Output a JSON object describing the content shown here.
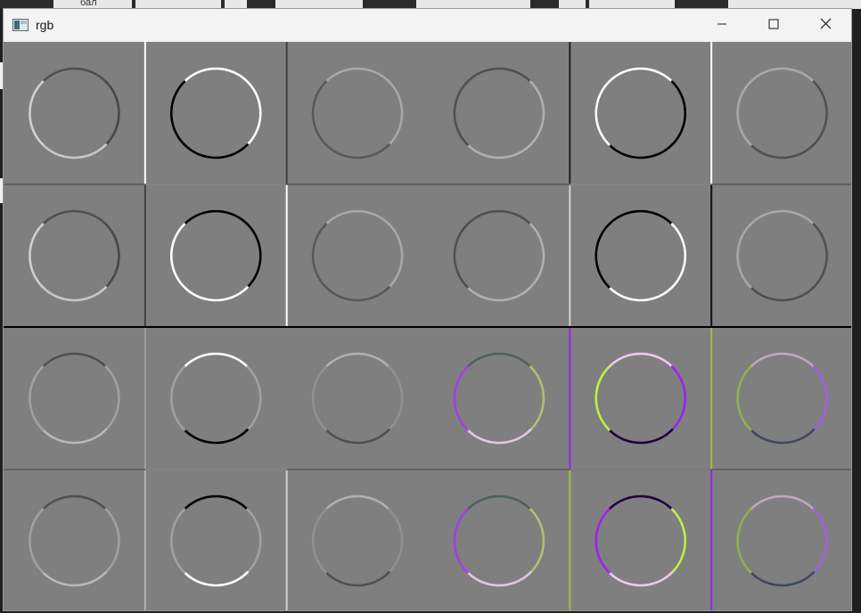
{
  "window": {
    "title": "rgb"
  },
  "background_window": {
    "label": "бал"
  },
  "icons": {
    "app": "image-window-icon",
    "minimize": "minimize-icon",
    "maximize": "maximize-icon",
    "close": "close-icon"
  },
  "colors": {
    "canvas_gray": "#7f7f7f",
    "titlebar": "#f3f3f3",
    "purple": "#a020f0",
    "yellow_green": "#c0f040",
    "pink": "#f0c0e0"
  },
  "grid": {
    "rows": 4,
    "cols": 6,
    "cells": [
      [
        {
          "top": "#505050",
          "bottom": "#c8c8c8",
          "left": "#d0d0d0",
          "right": "#484848"
        },
        {
          "top": "#ffffff",
          "bottom": "#000000",
          "left": "#000000",
          "right": "#ffffff"
        },
        {
          "top": "#a8a8a8",
          "bottom": "#585858",
          "left": "#585858",
          "right": "#a8a8a8"
        },
        {
          "top": "#505050",
          "bottom": "#b0b0b0",
          "left": "#505050",
          "right": "#b0b0b0"
        },
        {
          "top": "#ffffff",
          "bottom": "#000000",
          "left": "#ffffff",
          "right": "#000000"
        },
        {
          "top": "#a8a8a8",
          "bottom": "#505050",
          "left": "#a8a8a8",
          "right": "#505050"
        }
      ],
      [
        {
          "top": "#505050",
          "bottom": "#c8c8c8",
          "left": "#d0d0d0",
          "right": "#484848"
        },
        {
          "top": "#000000",
          "bottom": "#ffffff",
          "left": "#ffffff",
          "right": "#000000"
        },
        {
          "top": "#a8a8a8",
          "bottom": "#585858",
          "left": "#585858",
          "right": "#a8a8a8"
        },
        {
          "top": "#505050",
          "bottom": "#b0b0b0",
          "left": "#505050",
          "right": "#b0b0b0"
        },
        {
          "top": "#000000",
          "bottom": "#ffffff",
          "left": "#000000",
          "right": "#ffffff"
        },
        {
          "top": "#a8a8a8",
          "bottom": "#505050",
          "left": "#a8a8a8",
          "right": "#505050"
        }
      ],
      [
        {
          "top": "#505050",
          "bottom": "#b8b8b8",
          "left": "#a0a0a0",
          "right": "#a0a0a0"
        },
        {
          "top": "#ffffff",
          "bottom": "#000000",
          "left": "#a0a0a0",
          "right": "#a0a0a0"
        },
        {
          "top": "#b0b0b0",
          "bottom": "#505050",
          "left": "#909090",
          "right": "#909090"
        },
        {
          "top": "#506060",
          "bottom": "#e0c8e0",
          "left": "#a040e0",
          "right": "#b0c070"
        },
        {
          "top": "#f0c8f0",
          "bottom": "#200040",
          "left": "#c0f040",
          "right": "#a020f0"
        },
        {
          "top": "#c0a8c0",
          "bottom": "#404860",
          "left": "#90b050",
          "right": "#a060e0"
        }
      ],
      [
        {
          "top": "#505050",
          "bottom": "#b8b8b8",
          "left": "#a0a0a0",
          "right": "#a0a0a0"
        },
        {
          "top": "#000000",
          "bottom": "#ffffff",
          "left": "#a0a0a0",
          "right": "#a0a0a0"
        },
        {
          "top": "#b0b0b0",
          "bottom": "#505050",
          "left": "#909090",
          "right": "#909090"
        },
        {
          "top": "#506060",
          "bottom": "#e0c8e0",
          "left": "#a040e0",
          "right": "#b0c070"
        },
        {
          "top": "#200040",
          "bottom": "#f0c8f0",
          "left": "#a020f0",
          "right": "#c0f040"
        },
        {
          "top": "#c0a8c0",
          "bottom": "#404860",
          "left": "#90b050",
          "right": "#a060e0"
        }
      ]
    ],
    "dividers": [
      {
        "row": 0,
        "col": 1,
        "side": "left",
        "color": "#ffffff"
      },
      {
        "row": 0,
        "col": 1,
        "side": "bottom",
        "color": "#ffffff"
      },
      {
        "row": 0,
        "col": 2,
        "side": "left",
        "color": "#404040"
      },
      {
        "row": 0,
        "col": 4,
        "side": "left",
        "color": "#202020"
      },
      {
        "row": 0,
        "col": 4,
        "side": "bottom",
        "color": "#ffffff"
      },
      {
        "row": 0,
        "col": 4,
        "side": "right",
        "color": "#ffffff"
      },
      {
        "row": 1,
        "col": 0,
        "side": "right",
        "color": "#404040"
      },
      {
        "row": 1,
        "col": 1,
        "side": "right",
        "color": "#ffffff"
      },
      {
        "row": 1,
        "col": 4,
        "side": "left",
        "color": "#d0d0d0"
      },
      {
        "row": 1,
        "col": 4,
        "side": "right",
        "color": "#101010"
      },
      {
        "row": 1,
        "col": 0,
        "side": "bottom",
        "color": "#000000"
      },
      {
        "row": 2,
        "col": 1,
        "side": "left",
        "color": "#a0a0a0"
      },
      {
        "row": 2,
        "col": 1,
        "side": "bottom",
        "color": "#ffffff"
      },
      {
        "row": 2,
        "col": 4,
        "side": "left",
        "color": "#a020f0"
      },
      {
        "row": 2,
        "col": 4,
        "side": "right",
        "color": "#a0c040"
      },
      {
        "row": 2,
        "col": 4,
        "side": "bottom",
        "color": "#f0d0f0"
      },
      {
        "row": 3,
        "col": 1,
        "side": "left",
        "color": "#b0b0b0"
      },
      {
        "row": 3,
        "col": 2,
        "side": "left",
        "color": "#d0d0d0"
      },
      {
        "row": 3,
        "col": 4,
        "side": "left",
        "color": "#a0c040"
      },
      {
        "row": 3,
        "col": 4,
        "side": "right",
        "color": "#a020f0"
      }
    ]
  }
}
